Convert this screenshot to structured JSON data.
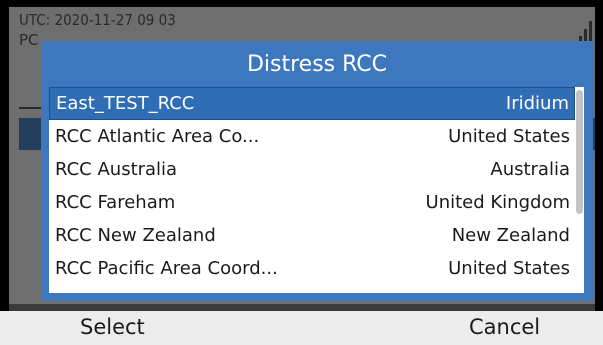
{
  "status": {
    "utc_label": "UTC:",
    "utc_value": "2020-11-27  09 03",
    "line2_fragment": "PC"
  },
  "dialog": {
    "title": "Distress RCC",
    "rows": [
      {
        "name": "East_TEST_RCC",
        "country": "Iridium",
        "selected": true
      },
      {
        "name": "RCC Atlantic Area Co...",
        "country": "United States",
        "selected": false
      },
      {
        "name": "RCC Australia",
        "country": "Australia",
        "selected": false
      },
      {
        "name": "RCC Fareham",
        "country": "United Kingdom",
        "selected": false
      },
      {
        "name": "RCC New Zealand",
        "country": "New Zealand",
        "selected": false
      },
      {
        "name": "RCC Pacific Area Coord...",
        "country": "United States",
        "selected": false
      }
    ],
    "scroll_position_fraction": 0.0,
    "scroll_visible_fraction": 0.62
  },
  "softkeys": {
    "left_label": "Select",
    "right_label": "Cancel"
  },
  "colors": {
    "accent": "#3d78bf",
    "selected_row": "#2f6db5",
    "screen_bg": "#6e6e6e",
    "softkey_bar": "#ececec"
  },
  "icons": [
    "signal-strength-icon"
  ]
}
